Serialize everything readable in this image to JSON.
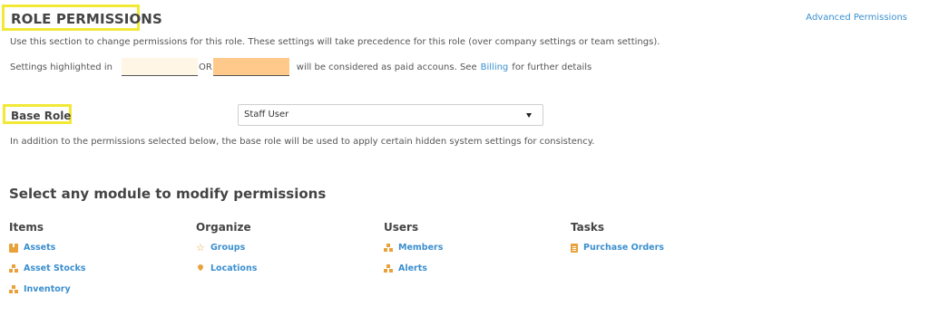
{
  "header": {
    "title": "ROLE PERMISSIONS",
    "advanced_link": "Advanced Permissions",
    "description": "Use this section to change permissions for this role. These settings will take precedence for this role (over company settings or team settings)."
  },
  "highlight_legend": {
    "prefix": "Settings highlighted in",
    "or": "OR",
    "suffix": "will be considered as paid accouns. See",
    "billing_link": "Billing",
    "tail": "for further details",
    "color_light": "#fff6e6",
    "color_dark": "#fec98b"
  },
  "base_role": {
    "label": "Base Role",
    "selected": "Staff User",
    "description": "In addition to the permissions selected below, the base role will be used to apply certain hidden system settings for consistency."
  },
  "modules": {
    "title": "Select any module to modify permissions",
    "columns": [
      {
        "heading": "Items",
        "items": [
          {
            "label": "Assets",
            "icon": "box-icon"
          },
          {
            "label": "Asset Stocks",
            "icon": "stack-icon"
          },
          {
            "label": "Inventory",
            "icon": "stack-icon"
          }
        ]
      },
      {
        "heading": "Organize",
        "items": [
          {
            "label": "Groups",
            "icon": "star-icon"
          },
          {
            "label": "Locations",
            "icon": "location-pin-icon"
          }
        ]
      },
      {
        "heading": "Users",
        "items": [
          {
            "label": "Members",
            "icon": "members-icon"
          },
          {
            "label": "Alerts",
            "icon": "alert-icon"
          }
        ]
      },
      {
        "heading": "Tasks",
        "items": [
          {
            "label": "Purchase Orders",
            "icon": "document-icon"
          }
        ]
      }
    ]
  },
  "colors": {
    "link": "#3b8fcf",
    "icon": "#e9a23b",
    "highlight_border": "#f2e936"
  }
}
